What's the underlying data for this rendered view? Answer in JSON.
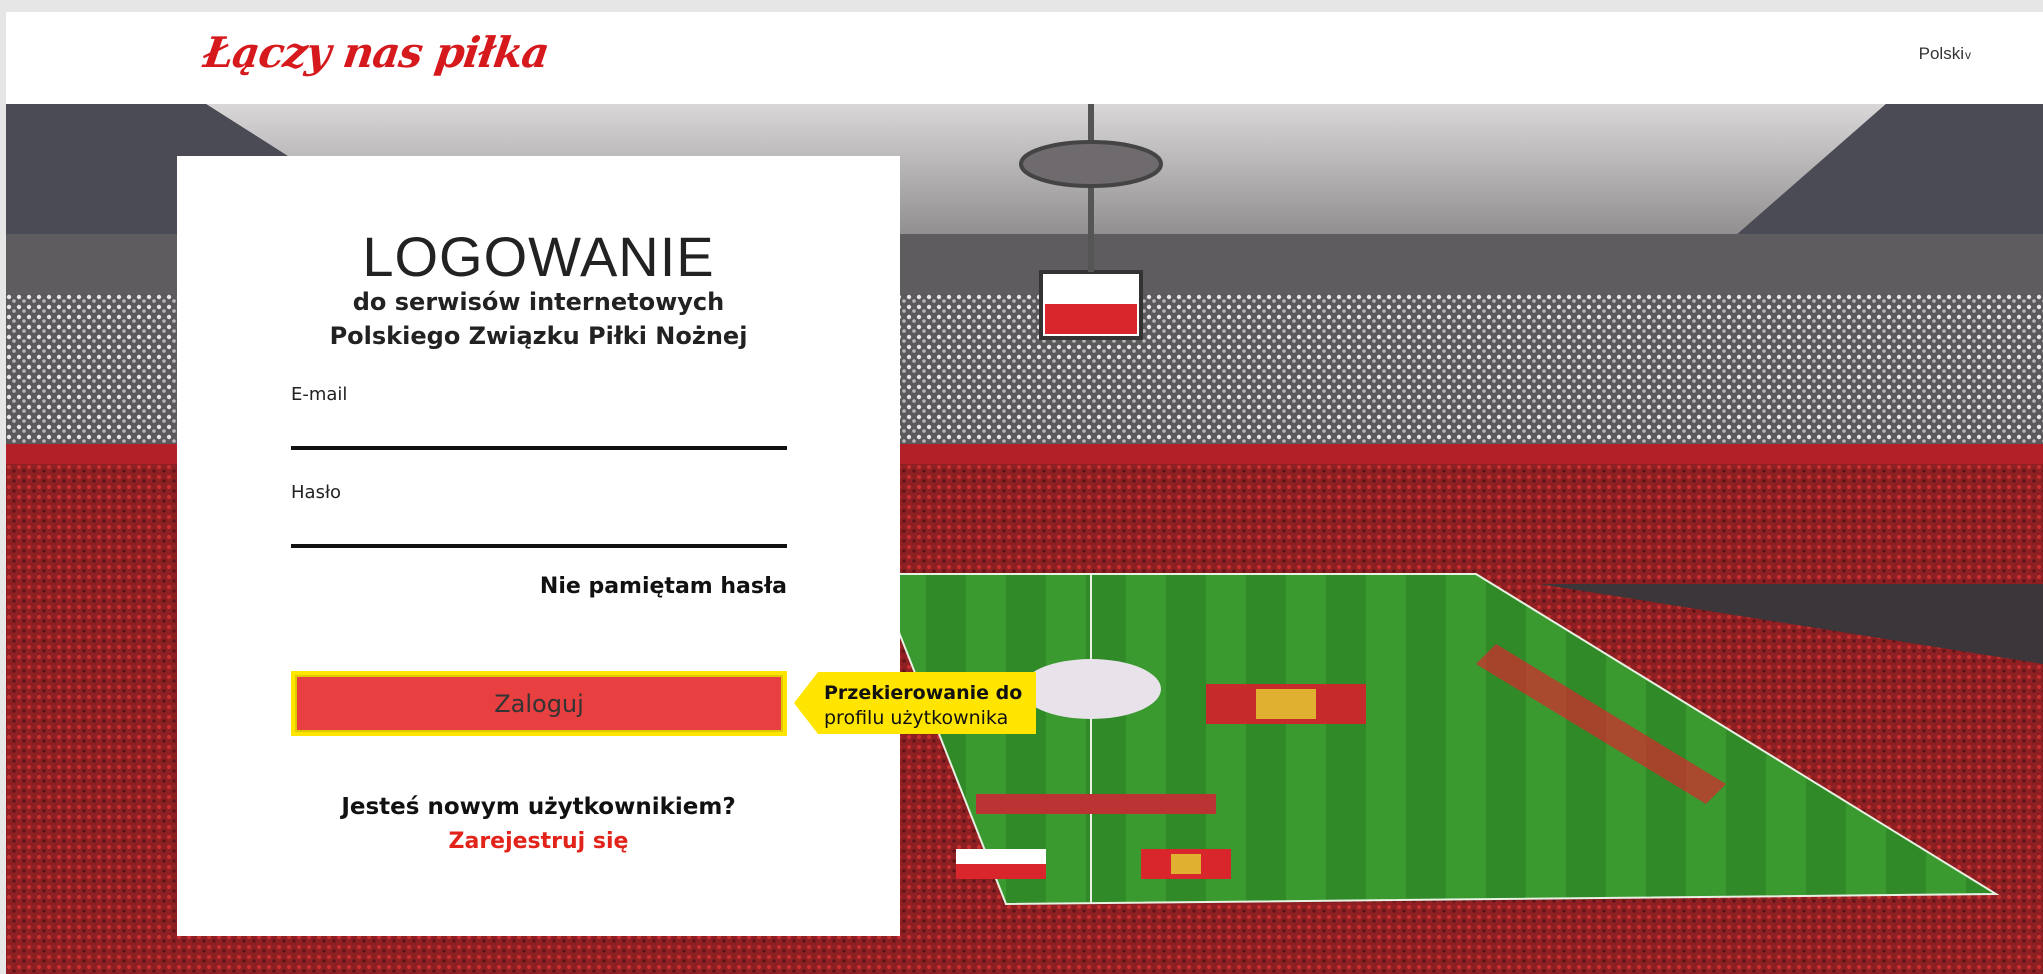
{
  "header": {
    "brand": "Łączy nas piłka",
    "language": "Polski",
    "language_chevron": "v"
  },
  "login": {
    "title": "LOGOWANIE",
    "subtitle_line1": "do serwisów internetowych",
    "subtitle_line2": "Polskiego Związku Piłki Nożnej",
    "email_label": "E-mail",
    "email_value": "",
    "password_label": "Hasło",
    "password_value": "",
    "forgot_password": "Nie pamiętam hasła",
    "submit": "Zaloguj",
    "new_user_question": "Jesteś nowym użytkownikiem?",
    "register_link": "Zarejestruj się"
  },
  "callout": {
    "line1": "Przekierowanie do",
    "line2": "profilu użytkownika"
  },
  "colors": {
    "brand_red": "#d6191c",
    "button_red": "#e84040",
    "highlight_yellow": "#ffe500",
    "link_red": "#e2231a"
  }
}
